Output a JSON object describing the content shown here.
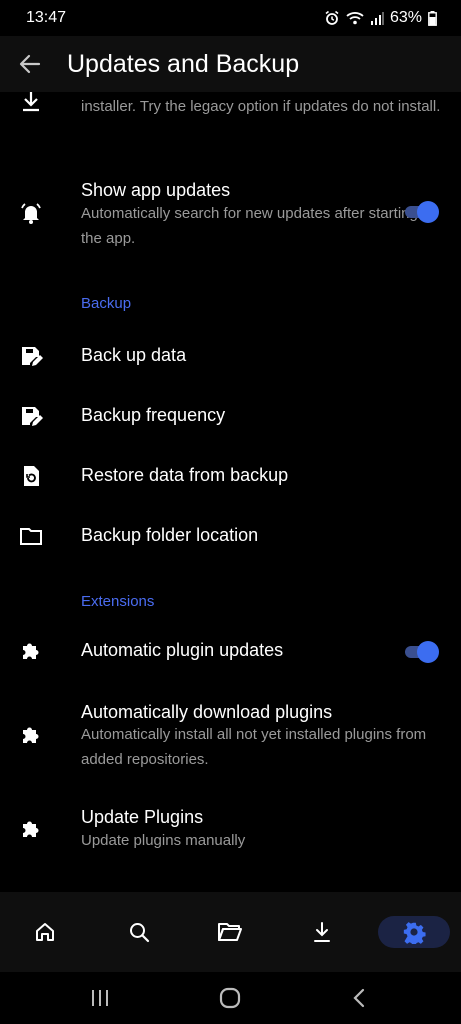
{
  "status": {
    "time": "13:47",
    "battery": "63%"
  },
  "header": {
    "title": "Updates and Backup"
  },
  "items": {
    "installer_sub": "installer. Try the legacy option if updates do not install.",
    "show_updates": {
      "title": "Show app updates",
      "sub": "Automatically search for new updates after starting the app.",
      "enabled": true
    },
    "backup_section": "Backup",
    "back_up_data": "Back up data",
    "backup_frequency": "Backup frequency",
    "restore": "Restore data from backup",
    "folder": "Backup folder location",
    "extensions_section": "Extensions",
    "auto_plugin_updates": {
      "title": "Automatic plugin updates",
      "enabled": true
    },
    "auto_download": {
      "title": "Automatically download plugins",
      "sub": "Automatically install all not yet installed plugins from added repositories."
    },
    "update_plugins": {
      "title": "Update Plugins",
      "sub": "Update plugins manually"
    }
  },
  "nav": [
    "home-icon",
    "search-icon",
    "folder-open-icon",
    "download-icon",
    "gear-icon"
  ],
  "colors": {
    "accent": "#4a6cf0",
    "toggle_on": "#3c6df0",
    "bar_bg": "#0f0f0f"
  }
}
